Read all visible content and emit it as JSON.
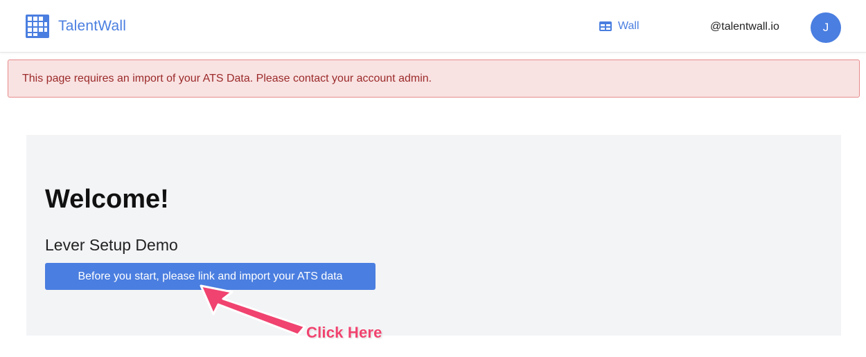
{
  "header": {
    "brand_name": "TalentWall",
    "brand_icon": "grid-logo-icon",
    "nav_wall_label": "Wall",
    "nav_wall_icon": "table-icon",
    "user_domain": "@talentwall.io",
    "avatar_initial": "J"
  },
  "alert": {
    "message": "This page requires an import of your ATS Data. Please contact your account admin."
  },
  "main": {
    "heading": "Welcome!",
    "subheading": "Lever Setup Demo",
    "cta_label": "Before you start, please link and import your ATS data"
  },
  "annotation": {
    "text": "Click Here"
  },
  "colors": {
    "accent": "#4a7ee0",
    "alert_bg": "#f9e2e2",
    "alert_border": "#e68a8a",
    "alert_text": "#9b2a2a",
    "annotation": "#f0436f",
    "card_bg": "#f3f4f6"
  }
}
